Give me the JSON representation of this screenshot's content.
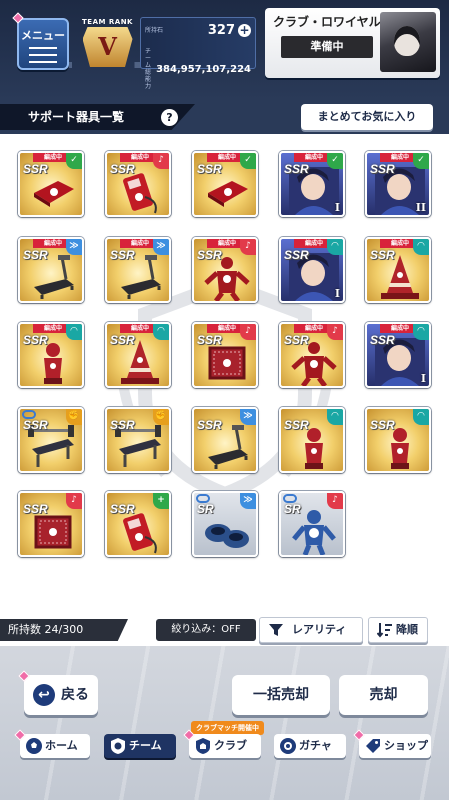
{
  "header": {
    "menu_label": "メニュー",
    "team_rank_label": "TEAM RANK",
    "team_rank_value": "V",
    "currency_label": "所持石",
    "currency_value": "327",
    "power_label": "チーム総能力",
    "power_value": "384,957,107,224",
    "club_title": "クラブ・ロワイヤル",
    "club_status": "準備中"
  },
  "section": {
    "title": "サポート器具一覧",
    "help_icon": "?",
    "favorite_button": "まとめてお気に入り"
  },
  "items": [
    {
      "rarity": "SSR",
      "tag": "編成中",
      "badge": "check-icon",
      "badge_color": "green",
      "kind": "mat"
    },
    {
      "rarity": "SSR",
      "tag": "編成中",
      "badge": "whistle-icon",
      "badge_color": "red",
      "kind": "stopwatch"
    },
    {
      "rarity": "SSR",
      "tag": "編成中",
      "badge": "check-icon",
      "badge_color": "green",
      "kind": "mat"
    },
    {
      "rarity": "SSR",
      "tag": "編成中",
      "badge": "check-icon",
      "badge_color": "green",
      "kind": "character",
      "level": "I"
    },
    {
      "rarity": "SSR",
      "tag": "編成中",
      "badge": "check-icon",
      "badge_color": "green",
      "kind": "character",
      "level": "II"
    },
    {
      "rarity": "SSR",
      "tag": "編成中",
      "badge": "runner-icon",
      "badge_color": "blue",
      "kind": "treadmill"
    },
    {
      "rarity": "SSR",
      "tag": "編成中",
      "badge": "runner-icon",
      "badge_color": "blue",
      "kind": "treadmill"
    },
    {
      "rarity": "SSR",
      "tag": "編成中",
      "badge": "whistle-icon",
      "badge_color": "red",
      "kind": "dummy"
    },
    {
      "rarity": "SSR",
      "tag": "編成中",
      "badge": "cap-icon",
      "badge_color": "teal",
      "kind": "character",
      "level": "I"
    },
    {
      "rarity": "SSR",
      "tag": "編成中",
      "badge": "cap-icon",
      "badge_color": "teal",
      "kind": "cone"
    },
    {
      "rarity": "SSR",
      "tag": "編成中",
      "badge": "cap-icon",
      "badge_color": "teal",
      "kind": "target"
    },
    {
      "rarity": "SSR",
      "tag": "編成中",
      "badge": "cap-icon",
      "badge_color": "teal",
      "kind": "cone"
    },
    {
      "rarity": "SSR",
      "tag": "編成中",
      "badge": "whistle-icon",
      "badge_color": "red",
      "kind": "goal"
    },
    {
      "rarity": "SSR",
      "tag": "編成中",
      "badge": "whistle-icon",
      "badge_color": "red",
      "kind": "dummy"
    },
    {
      "rarity": "SSR",
      "tag": "編成中",
      "badge": "cap-icon",
      "badge_color": "teal",
      "kind": "character",
      "level": "I"
    },
    {
      "rarity": "SSR",
      "tag": "",
      "badge": "fist-icon",
      "badge_color": "gold",
      "kind": "bench",
      "linked": true
    },
    {
      "rarity": "SSR",
      "tag": "",
      "badge": "fist-icon",
      "badge_color": "gold",
      "kind": "bench"
    },
    {
      "rarity": "SSR",
      "tag": "",
      "badge": "runner-icon",
      "badge_color": "blue",
      "kind": "treadmill"
    },
    {
      "rarity": "SSR",
      "tag": "",
      "badge": "cap-icon",
      "badge_color": "teal",
      "kind": "target"
    },
    {
      "rarity": "SSR",
      "tag": "",
      "badge": "cap-icon",
      "badge_color": "teal",
      "kind": "target"
    },
    {
      "rarity": "SSR",
      "tag": "",
      "badge": "whistle-icon",
      "badge_color": "red",
      "kind": "goal"
    },
    {
      "rarity": "SSR",
      "tag": "",
      "badge": "plus-icon",
      "badge_color": "green",
      "kind": "stopwatch"
    },
    {
      "rarity": "SR",
      "tag": "",
      "badge": "runner-icon",
      "badge_color": "blue",
      "kind": "rings",
      "linked": true
    },
    {
      "rarity": "SR",
      "tag": "",
      "badge": "whistle-icon",
      "badge_color": "red",
      "kind": "robot",
      "linked": true
    }
  ],
  "footer": {
    "count_label": "所持数 24/300",
    "filter_label": "絞り込み：OFF",
    "rarity_button": "レアリティ",
    "order_button": "降順"
  },
  "actions": {
    "back": "戻る",
    "bulk_sell": "一括売却",
    "sell": "売却"
  },
  "nav": {
    "home": "ホーム",
    "team": "チーム",
    "club": "クラブ",
    "club_badge": "クラブマッチ開催中",
    "gacha": "ガチャ",
    "shop": "ショップ"
  },
  "colors": {
    "header_navy": "#1d2a44",
    "tag_red": "#d8233b",
    "active_tab": "#1f3463",
    "accent_pink": "#f06ca8"
  }
}
